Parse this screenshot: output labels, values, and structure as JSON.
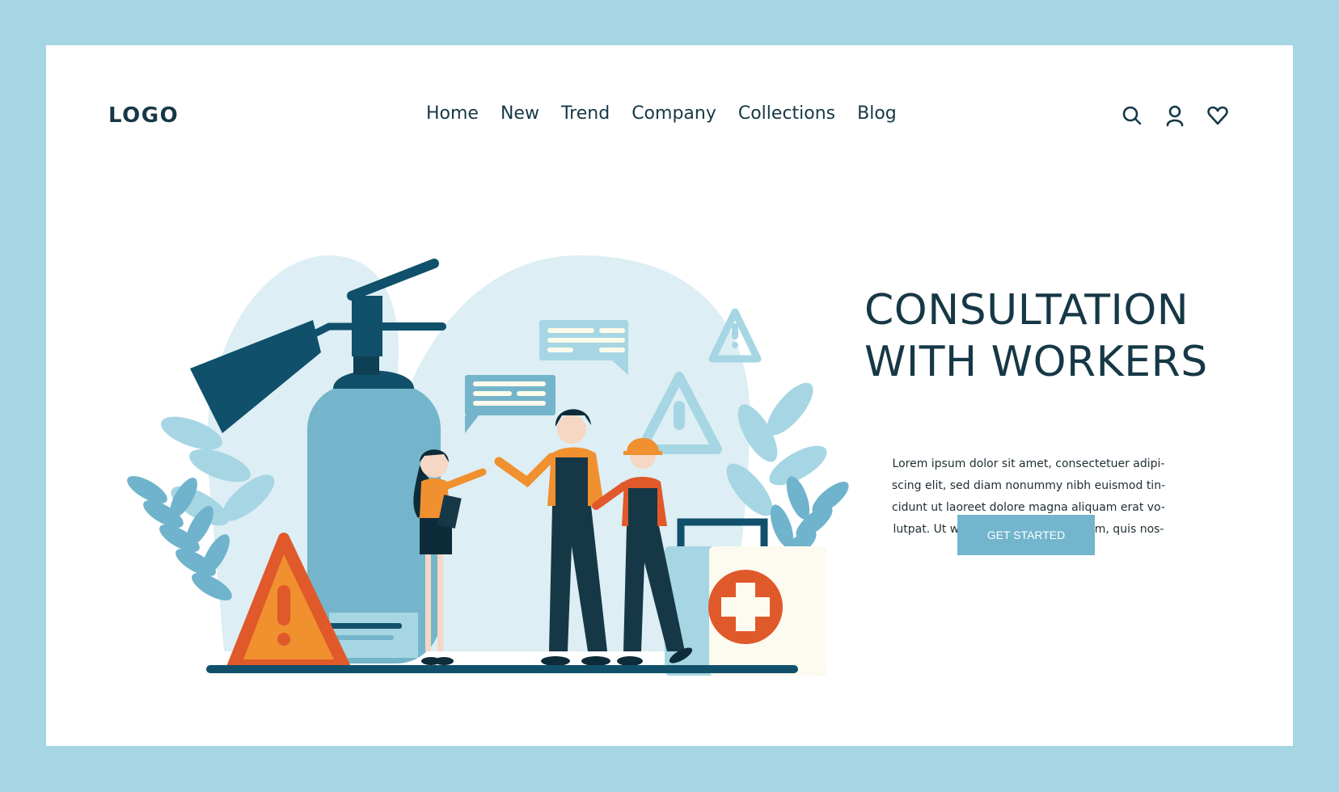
{
  "header": {
    "logo": "LOGO",
    "nav": [
      "Home",
      "New",
      "Trend",
      "Company",
      "Collections",
      "Blog"
    ],
    "icons": [
      "search-icon",
      "user-icon",
      "heart-icon"
    ]
  },
  "hero": {
    "title_lines": [
      "CONSULTATION",
      "WITH WORKERS"
    ],
    "paragraph_lines": [
      "Lorem ipsum dolor sit amet, consectetuer adipi-",
      "scing elit, sed diam nonummy nibh euismod tin-",
      "cidunt ut laoreet dolore magna aliquam erat vo-",
      "lutpat. Ut wisi enim ad minim veniam, quis nos-"
    ],
    "cta_label": "GET STARTED"
  },
  "illustration": {
    "description": "Workers consulting beside a fire extinguisher, warning signs, speech bubbles and a first-aid kit",
    "elements": [
      "fire-extinguisher",
      "warning-sign",
      "speech-bubble",
      "speech-bubble",
      "warning-sign",
      "warning-sign",
      "first-aid-kit",
      "woman-with-tablet",
      "worker",
      "worker-with-helmet",
      "leaves",
      "floor"
    ]
  },
  "colors": {
    "frame": "#a6d6e3",
    "text_dark": "#163846",
    "accent_button": "#72b5cc",
    "navy": "#10506a",
    "orange": "#f0902f",
    "red_orange": "#e0592a",
    "light_blob": "#ddeef4"
  }
}
